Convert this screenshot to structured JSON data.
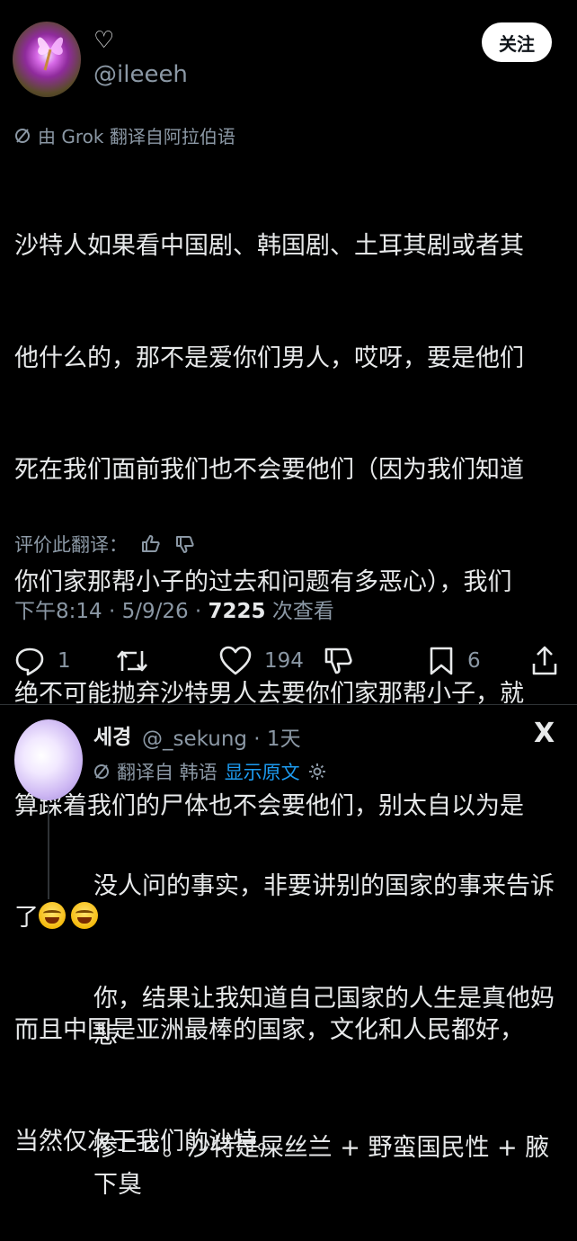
{
  "post": {
    "heart_glyph": "♡",
    "handle": "@ileeeh",
    "follow_label": "关注",
    "translated_by": "由 Grok 翻译自阿拉伯语",
    "body_lines": [
      "沙特人如果看中国剧、韩国剧、土耳其剧或者其",
      "他什么的，那不是爱你们男人，哎呀，要是他们",
      "死在我们面前我们也不会要他们（因为我们知道",
      "你们家那帮小子的过去和问题有多恶心），我们",
      "绝不可能抛弃沙特男人去要你们家那帮小子，就",
      "算踩着我们的尸体也不会要他们，别太自以为是",
      "了",
      "而且中国是亚洲最棒的国家，文化和人民都好，",
      "当然仅次于我们的沙特。"
    ],
    "rate_label": "评价此翻译：",
    "time_date": "下午8:14 · 5/9/26 · ",
    "views_count": "7225",
    "views_label": " 次查看",
    "actions": {
      "reply_count": "1",
      "repost_count": "",
      "like_count": "194",
      "bookmark_count": "6"
    },
    "emoji_name": "tears-of-joy-emoji"
  },
  "reply": {
    "name": "세경",
    "handle_time": "@_sekung · 1天",
    "platform": "X",
    "translated_from": "翻译自 韩语",
    "show_original": "显示原文",
    "body_lines": [
      "没人问的事实，非要讲别的国家的事来告诉",
      "你，结果让我知道自己国家的人生是真他妈悲",
      "惨ㄷㄷ。沙特是屎丝兰 + 野蛮国民性 + 腋下臭"
    ]
  },
  "colors": {
    "background": "#000000",
    "text": "#e7e9ea",
    "muted": "#8b98a5",
    "link": "#1d9bf0",
    "divider": "#2f3336"
  }
}
